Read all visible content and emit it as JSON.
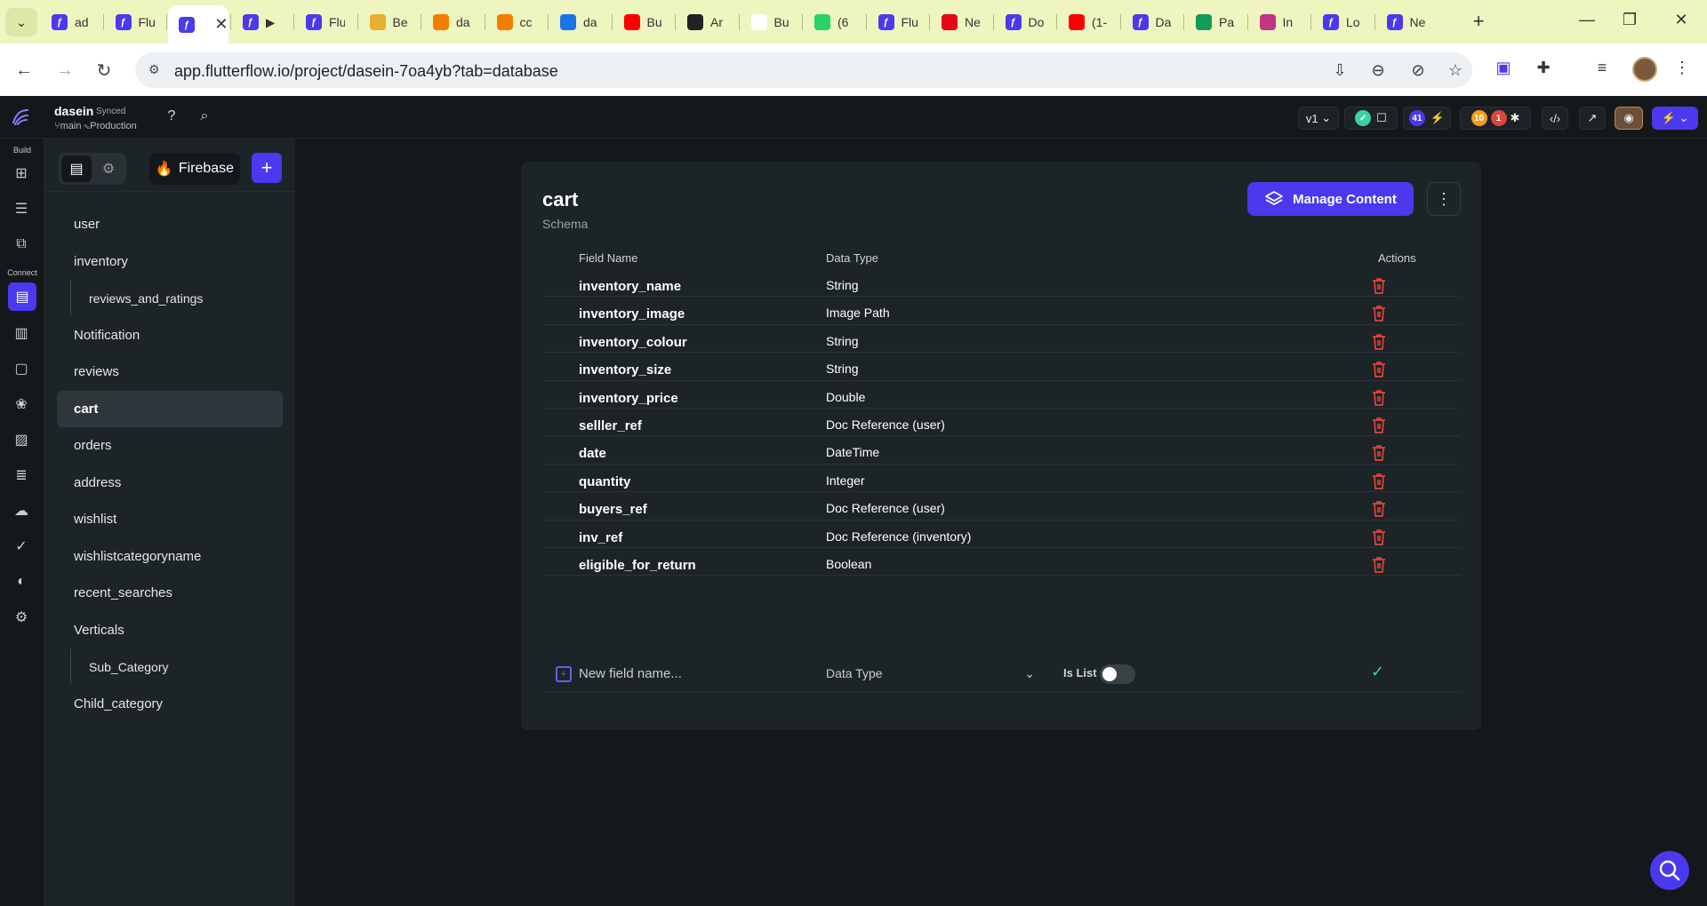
{
  "browser": {
    "tabs": [
      {
        "title": "ad",
        "icon": "flutterflow-icon",
        "color": "#4b39ef"
      },
      {
        "title": "Flu",
        "icon": "flutterflow-icon",
        "color": "#4b39ef"
      },
      {
        "title": "",
        "icon": "flutterflow-icon",
        "color": "#4b39ef",
        "active": true
      },
      {
        "title": "▶",
        "icon": "flutterflow-icon",
        "color": "#4b39ef"
      },
      {
        "title": "Flu",
        "icon": "flutterflow-icon",
        "color": "#4b39ef"
      },
      {
        "title": "Be",
        "icon": "folder-icon",
        "color": "#e8b030"
      },
      {
        "title": "da",
        "icon": "firebase-icon",
        "color": "#f57c00"
      },
      {
        "title": "cc",
        "icon": "firebase-icon",
        "color": "#f57c00"
      },
      {
        "title": "da",
        "icon": "at-icon",
        "color": "#1a73e8"
      },
      {
        "title": "Bu",
        "icon": "youtube-icon",
        "color": "#ff0000"
      },
      {
        "title": "Ar",
        "icon": "amazon-icon",
        "color": "#222222"
      },
      {
        "title": "Bu",
        "icon": "amazon-icon",
        "color": "#ffffff"
      },
      {
        "title": "(6",
        "icon": "whatsapp-icon",
        "color": "#25d366"
      },
      {
        "title": "Flu",
        "icon": "flutterflow-icon",
        "color": "#4b39ef"
      },
      {
        "title": "Ne",
        "icon": "netflix-icon",
        "color": "#e50914"
      },
      {
        "title": "Do",
        "icon": "flutterflow-icon",
        "color": "#4b39ef"
      },
      {
        "title": "(1-",
        "icon": "youtube-icon",
        "color": "#ff0000"
      },
      {
        "title": "Da",
        "icon": "flutterflow-icon",
        "color": "#4b39ef"
      },
      {
        "title": "Pa",
        "icon": "sheets-icon",
        "color": "#0f9d58"
      },
      {
        "title": "In",
        "icon": "instagram-icon",
        "color": "#c13584"
      },
      {
        "title": "Lo",
        "icon": "flutterflow-icon",
        "color": "#4b39ef"
      },
      {
        "title": "Ne",
        "icon": "flutterflow-icon",
        "color": "#4b39ef"
      }
    ],
    "url": "app.flutterflow.io/project/dasein-7oa4yb?tab=database"
  },
  "app": {
    "project_name": "dasein",
    "sync_status": "Synced",
    "branch": "main",
    "environment": "Production",
    "version": "v1",
    "badges": {
      "chat_count": "41",
      "warnings": "10",
      "errors": "1"
    },
    "accent": "#4b39ef"
  },
  "rail": {
    "build_label": "Build",
    "connect_label": "Connect"
  },
  "panel": {
    "backend": "Firebase",
    "collections": [
      {
        "label": "user",
        "sub": false,
        "active": false
      },
      {
        "label": "inventory",
        "sub": false,
        "active": false
      },
      {
        "label": "reviews_and_ratings",
        "sub": true,
        "active": false
      },
      {
        "label": "Notification",
        "sub": false,
        "active": false
      },
      {
        "label": "reviews",
        "sub": false,
        "active": false
      },
      {
        "label": "cart",
        "sub": false,
        "active": true
      },
      {
        "label": "orders",
        "sub": false,
        "active": false
      },
      {
        "label": "address",
        "sub": false,
        "active": false
      },
      {
        "label": "wishlist",
        "sub": false,
        "active": false
      },
      {
        "label": "wishlistcategoryname",
        "sub": false,
        "active": false
      },
      {
        "label": "recent_searches",
        "sub": false,
        "active": false
      },
      {
        "label": "Verticals",
        "sub": false,
        "active": false
      },
      {
        "label": "Sub_Category",
        "sub": true,
        "active": false
      },
      {
        "label": "Child_category",
        "sub": false,
        "active": false
      }
    ]
  },
  "schema": {
    "title": "cart",
    "subtitle": "Schema",
    "manage_label": "Manage Content",
    "headers": {
      "field": "Field Name",
      "type": "Data Type",
      "actions": "Actions"
    },
    "fields": [
      {
        "name": "inventory_name",
        "type": "String"
      },
      {
        "name": "inventory_image",
        "type": "Image Path"
      },
      {
        "name": "inventory_colour",
        "type": "String"
      },
      {
        "name": "inventory_size",
        "type": "String"
      },
      {
        "name": "inventory_price",
        "type": "Double"
      },
      {
        "name": "selller_ref",
        "type": "Doc Reference (user)"
      },
      {
        "name": "date",
        "type": "DateTime"
      },
      {
        "name": "quantity",
        "type": "Integer"
      },
      {
        "name": "buyers_ref",
        "type": "Doc Reference (user)"
      },
      {
        "name": "inv_ref",
        "type": "Doc Reference (inventory)"
      },
      {
        "name": "eligible_for_return",
        "type": "Boolean"
      }
    ],
    "new_field": {
      "placeholder": "New field name...",
      "type_placeholder": "Data Type",
      "is_list_label": "Is List",
      "is_list": false
    },
    "delete_color": "#e0443a"
  }
}
